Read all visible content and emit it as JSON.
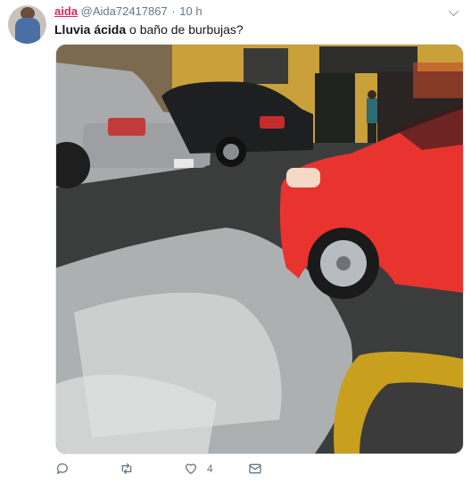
{
  "tweet": {
    "author_name": "aida",
    "handle": "@Aida72417867",
    "separator": "·",
    "time": "10 h",
    "text_bold": "Lluvia ácida",
    "text_rest": " o baño de burbujas?"
  },
  "actions": {
    "reply_icon": "reply-icon",
    "retweet_icon": "retweet-icon",
    "like_icon": "heart-icon",
    "like_count": "4",
    "dm_icon": "envelope-icon"
  },
  "colors": {
    "name": "#e0245e",
    "muted": "#657786",
    "text": "#14171a"
  }
}
